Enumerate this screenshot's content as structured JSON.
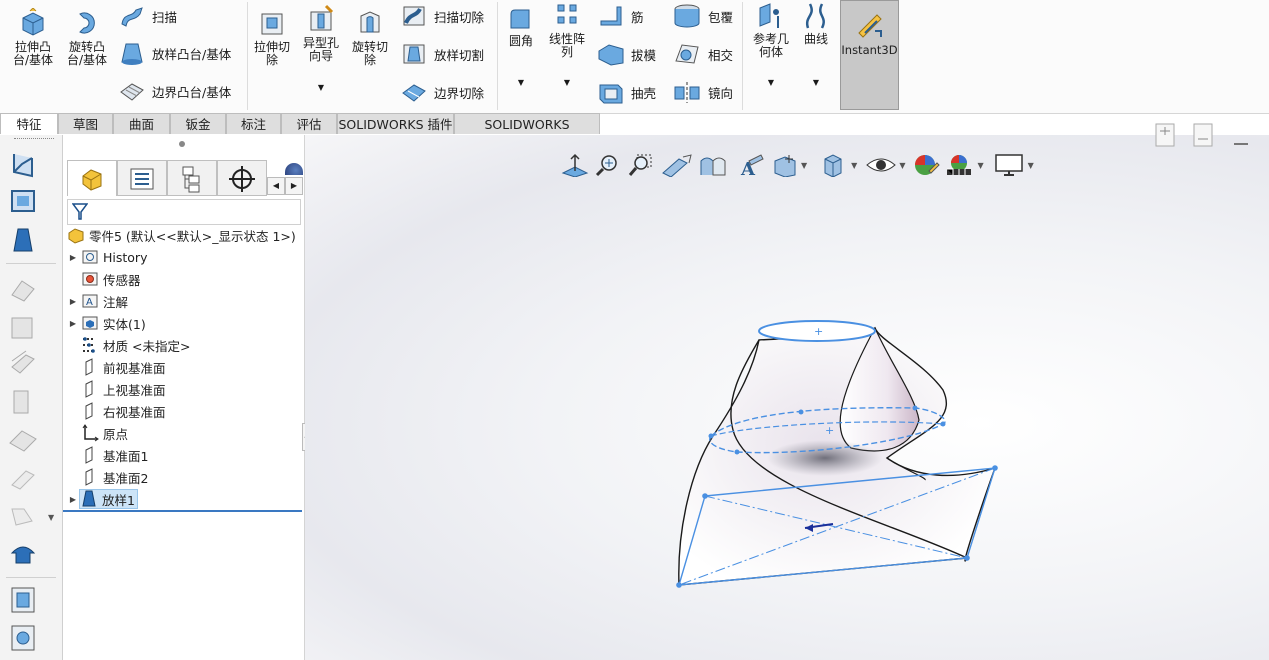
{
  "ribbon": {
    "extrude_boss": "拉伸凸\n台/基体",
    "revolve_boss": "旋转凸\n台/基体",
    "sweep": "扫描",
    "loft_boss": "放样凸台/基体",
    "boundary_boss": "边界凸台/基体",
    "extrude_cut": "拉伸切\n除",
    "hole_wizard": "异型孔\n向导",
    "revolve_cut": "旋转切\n除",
    "sweep_cut": "扫描切除",
    "loft_cut": "放样切割",
    "boundary_cut": "边界切除",
    "fillet": "圆角",
    "linear_pattern": "线性阵\n列",
    "rib": "筋",
    "draft": "拔模",
    "shell": "抽壳",
    "wrap": "包覆",
    "intersect": "相交",
    "mirror": "镜向",
    "ref_geometry": "参考几\n何体",
    "curves": "曲线",
    "instant3d": "Instant3D"
  },
  "tabs": [
    {
      "label": "特征",
      "active": true
    },
    {
      "label": "草图"
    },
    {
      "label": "曲面"
    },
    {
      "label": "钣金"
    },
    {
      "label": "标注"
    },
    {
      "label": "评估"
    },
    {
      "label": "SOLIDWORKS 插件"
    },
    {
      "label": "SOLIDWORKS Inspection"
    }
  ],
  "tree": {
    "root": "零件5  (默认<<默认>_显示状态 1>)",
    "items": [
      {
        "label": "History",
        "expandable": true,
        "icon": "history-icon"
      },
      {
        "label": "传感器",
        "expandable": false,
        "icon": "sensor-icon"
      },
      {
        "label": "注解",
        "expandable": true,
        "icon": "annotation-icon"
      },
      {
        "label": "实体(1)",
        "expandable": true,
        "icon": "solid-body-icon"
      },
      {
        "label": "材质 <未指定>",
        "expandable": false,
        "icon": "material-icon"
      },
      {
        "label": "前视基准面",
        "expandable": false,
        "icon": "plane-icon"
      },
      {
        "label": "上视基准面",
        "expandable": false,
        "icon": "plane-icon"
      },
      {
        "label": "右视基准面",
        "expandable": false,
        "icon": "plane-icon"
      },
      {
        "label": "原点",
        "expandable": false,
        "icon": "origin-icon"
      },
      {
        "label": "基准面1",
        "expandable": false,
        "icon": "plane-icon"
      },
      {
        "label": "基准面2",
        "expandable": false,
        "icon": "plane-icon"
      },
      {
        "label": "放样1",
        "expandable": true,
        "icon": "loft-feature-icon",
        "selected": true
      }
    ]
  },
  "colors": {
    "accent": "#4a90e2",
    "selection": "#cde4f7",
    "tab_bg": "#dedede"
  }
}
